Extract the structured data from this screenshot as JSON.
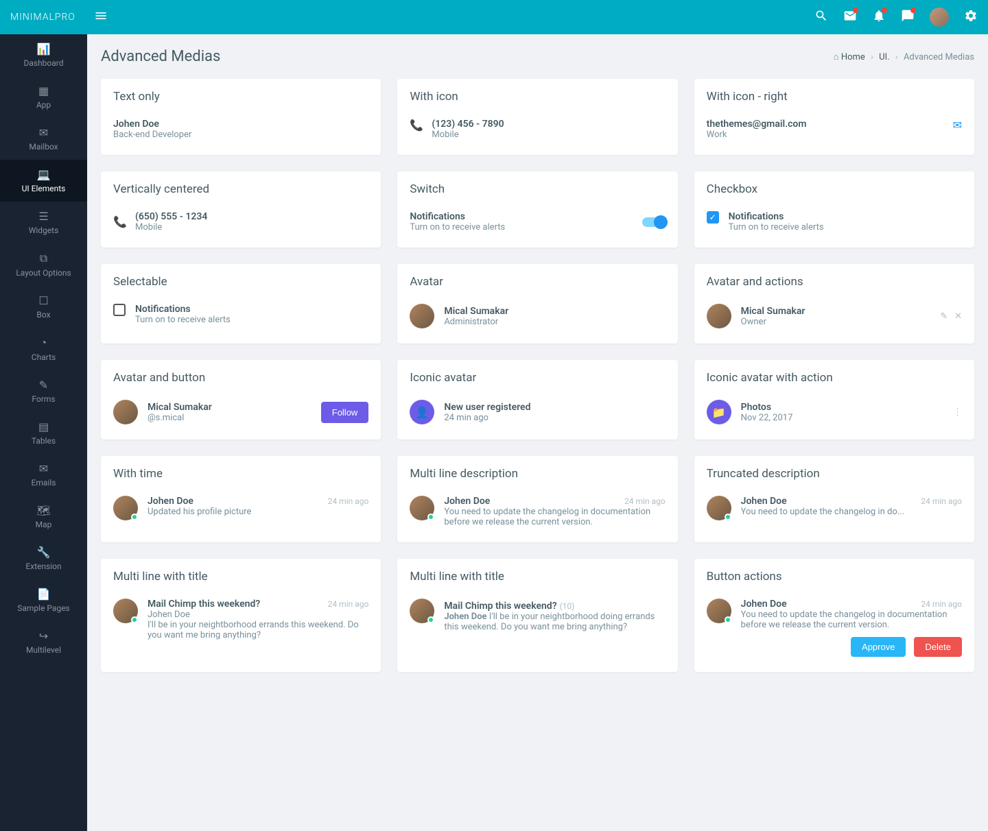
{
  "brand": {
    "name": "MINIMAL",
    "suffix": "PRO"
  },
  "sidebar": {
    "items": [
      {
        "label": "Dashboard",
        "icon": "dashboard"
      },
      {
        "label": "App",
        "icon": "grid"
      },
      {
        "label": "Mailbox",
        "icon": "mail"
      },
      {
        "label": "UI Elements",
        "icon": "laptop",
        "active": true
      },
      {
        "label": "Widgets",
        "icon": "bars"
      },
      {
        "label": "Layout Options",
        "icon": "copy"
      },
      {
        "label": "Box",
        "icon": "box"
      },
      {
        "label": "Charts",
        "icon": "pie"
      },
      {
        "label": "Forms",
        "icon": "edit"
      },
      {
        "label": "Tables",
        "icon": "table"
      },
      {
        "label": "Emails",
        "icon": "envelope"
      },
      {
        "label": "Map",
        "icon": "map"
      },
      {
        "label": "Extension",
        "icon": "wrench"
      },
      {
        "label": "Sample Pages",
        "icon": "file"
      },
      {
        "label": "Multilevel",
        "icon": "share"
      }
    ]
  },
  "page": {
    "title": "Advanced Medias",
    "breadcrumb": {
      "home": "Home",
      "section": "UI.",
      "current": "Advanced Medias"
    }
  },
  "cards": {
    "textOnly": {
      "title": "Text only",
      "name": "Johen Doe",
      "role": "Back-end Developer"
    },
    "withIcon": {
      "title": "With icon",
      "phone": "(123) 456 - 7890",
      "label": "Mobile"
    },
    "withIconRight": {
      "title": "With icon - right",
      "email": "thethemes@gmail.com",
      "label": "Work"
    },
    "vertCentered": {
      "title": "Vertically centered",
      "phone": "(650) 555 - 1234",
      "label": "Mobile"
    },
    "switch": {
      "title": "Switch",
      "heading": "Notifications",
      "text": "Turn on to receive alerts"
    },
    "checkbox": {
      "title": "Checkbox",
      "heading": "Notifications",
      "text": "Turn on to receive alerts"
    },
    "selectable": {
      "title": "Selectable",
      "heading": "Notifications",
      "text": "Turn on to receive alerts"
    },
    "avatar": {
      "title": "Avatar",
      "name": "Mical Sumakar",
      "role": "Administrator"
    },
    "avatarActions": {
      "title": "Avatar and actions",
      "name": "Mical Sumakar",
      "role": "Owner"
    },
    "avatarButton": {
      "title": "Avatar and button",
      "name": "Mical Sumakar",
      "handle": "@s.mical",
      "button": "Follow"
    },
    "iconicAvatar": {
      "title": "Iconic avatar",
      "heading": "New user registered",
      "time": "24 min ago"
    },
    "iconicAvatarAction": {
      "title": "Iconic avatar with action",
      "heading": "Photos",
      "date": "Nov 22, 2017"
    },
    "withTime": {
      "title": "With time",
      "name": "Johen Doe",
      "text": "Updated his profile picture",
      "time": "24 min ago"
    },
    "multiLine": {
      "title": "Multi line description",
      "name": "Johen Doe",
      "text": "You need to update the changelog in documentation before we release the current version.",
      "time": "24 min ago"
    },
    "truncated": {
      "title": "Truncated description",
      "name": "Johen Doe",
      "text": "You need to update the changelog in do...",
      "time": "24 min ago"
    },
    "multiTitle1": {
      "title": "Multi line with title",
      "subject": "Mail Chimp this weekend?",
      "name": "Johen Doe",
      "text": "I'll be in your neightborhood errands this weekend. Do you want me bring anything?",
      "time": "24 min ago"
    },
    "multiTitle2": {
      "title": "Multi line with title",
      "subject": "Mail Chimp this weekend?",
      "count": "(10)",
      "name": "Johen Doe",
      "text": "I'll be in your neightborhood doing errands this weekend. Do you want me bring anything?"
    },
    "buttonActions": {
      "title": "Button actions",
      "name": "Johen Doe",
      "text": "You need to update the changelog in documentation before we release the current version.",
      "time": "24 min ago",
      "approve": "Approve",
      "delete": "Delete"
    }
  }
}
